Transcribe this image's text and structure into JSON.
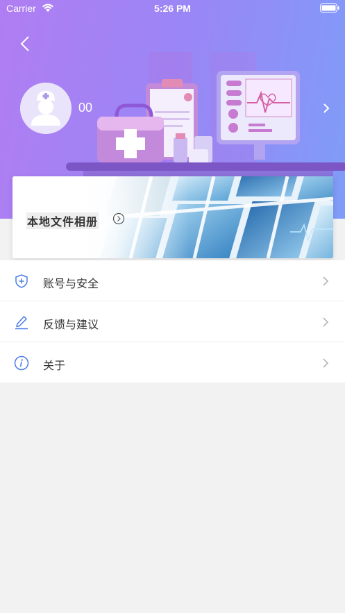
{
  "status_bar": {
    "carrier": "Carrier",
    "time": "5:26 PM"
  },
  "header": {
    "username": "00",
    "gradient_colors": [
      "#b07df2",
      "#7f9cf8"
    ]
  },
  "banner": {
    "title": "本地文件相册"
  },
  "menu": {
    "items": [
      {
        "label": "账号与安全",
        "icon": "shield-plus-icon"
      },
      {
        "label": "反馈与建议",
        "icon": "pencil-icon"
      },
      {
        "label": "关于",
        "icon": "info-circle-icon"
      }
    ]
  },
  "colors": {
    "icon_blue": "#4a7be8",
    "chevron_gray": "#b5b5b5",
    "background": "#f2f2f2"
  }
}
